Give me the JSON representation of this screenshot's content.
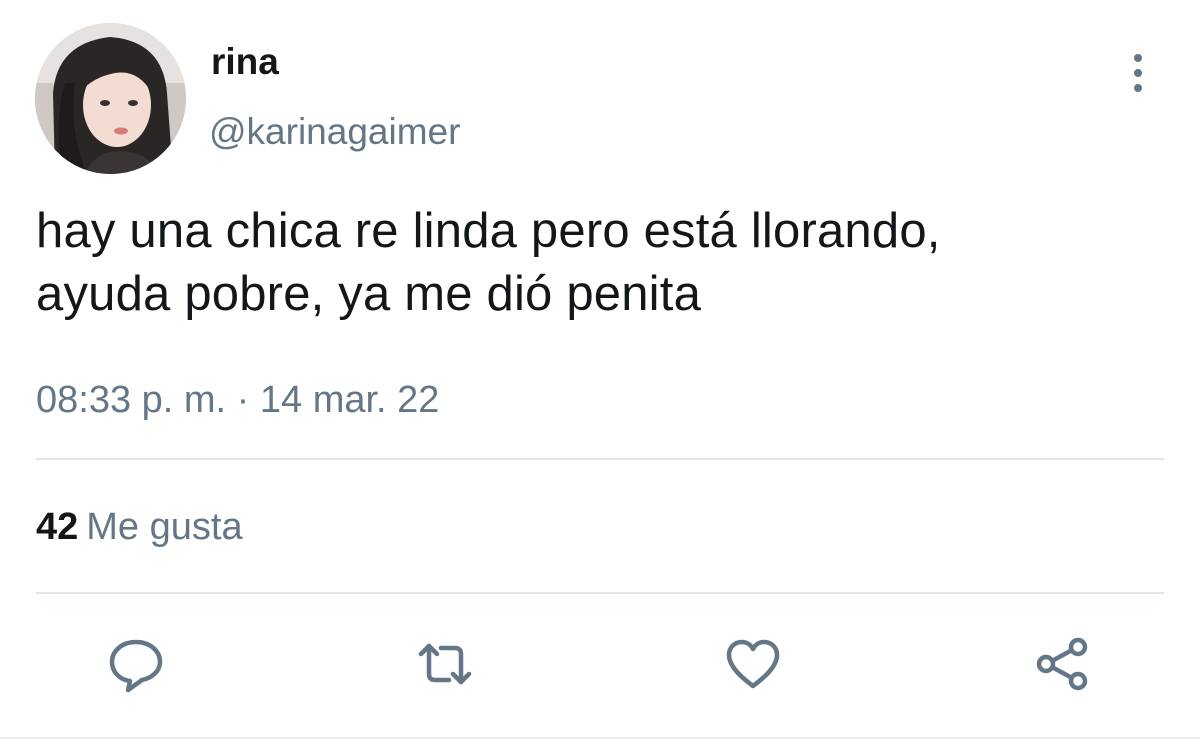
{
  "user": {
    "display_name": "rina",
    "handle": "@karinagaimer",
    "avatar_icon": "profile-photo"
  },
  "tweet": {
    "text_lines": [
      "hay una chica re linda pero está llorando,",
      "ayuda pobre, ya me dió penita"
    ],
    "timestamp": "08:33 p. m. · 14 mar. 22"
  },
  "stats": {
    "likes_count": "42",
    "likes_label": "Me gusta"
  },
  "actions": {
    "reply_icon": "comment-bubble",
    "retweet_icon": "retweet-arrows",
    "like_icon": "heart-outline",
    "share_icon": "share-nodes"
  },
  "colors": {
    "text_primary": "#14171a",
    "text_secondary": "#657786",
    "divider": "#e1e8ed"
  }
}
